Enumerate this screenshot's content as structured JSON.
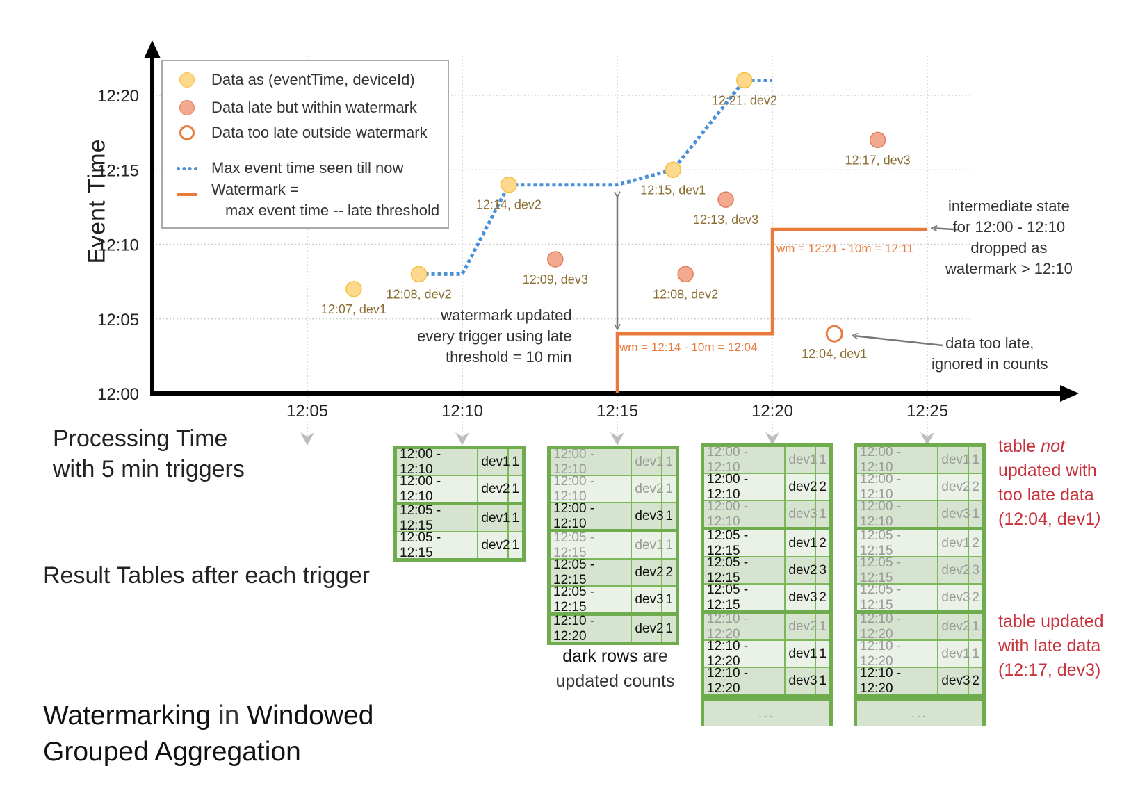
{
  "title": {
    "part1": "Watermarking",
    "part2": " in ",
    "part3": "Windowed",
    "line2": "Grouped Aggregation"
  },
  "labels": {
    "y_axis": "Event Time",
    "x_axis_line1": "Processing Time",
    "x_axis_line2": "with 5 min triggers",
    "result_tables": "Result Tables after each trigger",
    "dark_rows_1a": "dark rows",
    "dark_rows_1b": " are",
    "dark_rows_2": "updated counts"
  },
  "legend": {
    "items": [
      {
        "type": "ontime",
        "label": "Data as (eventTime, deviceId)"
      },
      {
        "type": "late",
        "label": "Data late but within watermark"
      },
      {
        "type": "toolate",
        "label": "Data too late outside watermark"
      },
      {
        "type": "maxline",
        "label": "Max event time seen till now"
      },
      {
        "type": "watermark",
        "label": "Watermark =",
        "label2": "max event time -- late threshold"
      }
    ]
  },
  "annotations": {
    "watermark_updated": [
      "watermark updated",
      "every trigger using late",
      "threshold = 10 min"
    ],
    "intermediate_state": [
      "intermediate state",
      "for 12:00 - 12:10",
      "dropped as",
      "watermark > 12:10"
    ],
    "too_late": [
      "data too late,",
      "ignored in counts"
    ],
    "wm1": "wm = 12:14 - 10m = 12:04",
    "wm2": "wm = 12:21 - 10m = 12:11",
    "not_updated": {
      "l1a": "table ",
      "l1b": "not",
      "l2": "updated with",
      "l3": "too late data",
      "l4a": "(12:04, dev1",
      "l4b": ")"
    },
    "updated_late": [
      "table updated",
      "with late data",
      "(12:17, dev3)"
    ]
  },
  "colors": {
    "ontime_fill": "#fed88c",
    "ontime_stroke": "#f4bf3c",
    "late_fill": "#f2a98f",
    "late_stroke": "#e07f5f",
    "toolate_stroke": "#e87a3c",
    "max_line": "#4a90d9",
    "watermark": "#e87a3c",
    "point_label": "#8b6d32",
    "table_border": "#6fac4d",
    "note_red": "#c8323c"
  },
  "chart_data": {
    "type": "scatter",
    "title": "Watermarking in Windowed Grouped Aggregation",
    "xlabel": "Processing Time with 5 min triggers",
    "ylabel": "Event Time",
    "x_ticks": [
      "12:05",
      "12:10",
      "12:15",
      "12:20",
      "12:25"
    ],
    "x_tick_values": [
      5,
      10,
      15,
      20,
      25
    ],
    "y_ticks": [
      "12:00",
      "12:05",
      "12:10",
      "12:15",
      "12:20"
    ],
    "y_tick_values": [
      0,
      5,
      10,
      15,
      20
    ],
    "xlim": [
      0,
      28.5
    ],
    "ylim": [
      0,
      22
    ],
    "grid": true,
    "points": [
      {
        "proc": 6.5,
        "event": 7,
        "label": "12:07, dev1",
        "kind": "ontime"
      },
      {
        "proc": 8.6,
        "event": 8,
        "label": "12:08, dev2",
        "kind": "ontime"
      },
      {
        "proc": 11.5,
        "event": 14,
        "label": "12:14, dev2",
        "kind": "ontime"
      },
      {
        "proc": 13.0,
        "event": 9,
        "label": "12:09, dev3",
        "kind": "late"
      },
      {
        "proc": 16.8,
        "event": 15,
        "label": "12:15, dev1",
        "kind": "ontime"
      },
      {
        "proc": 17.2,
        "event": 8,
        "label": "12:08, dev2",
        "kind": "late"
      },
      {
        "proc": 18.5,
        "event": 13,
        "label": "12:13, dev3",
        "kind": "late"
      },
      {
        "proc": 19.1,
        "event": 21,
        "label": "12:21, dev2",
        "kind": "ontime"
      },
      {
        "proc": 22.0,
        "event": 4,
        "label": "12:04, dev1",
        "kind": "toolate"
      },
      {
        "proc": 23.4,
        "event": 17,
        "label": "12:17, dev3",
        "kind": "late"
      }
    ],
    "max_event_line": [
      [
        8.6,
        8
      ],
      [
        10,
        8
      ],
      [
        11.5,
        14
      ],
      [
        15,
        14
      ],
      [
        16.8,
        15
      ],
      [
        19.1,
        21
      ],
      [
        20,
        21
      ]
    ],
    "watermark_line": [
      [
        15,
        0
      ],
      [
        15,
        4
      ],
      [
        20,
        4
      ],
      [
        20,
        11
      ],
      [
        25,
        11
      ]
    ]
  },
  "tables": [
    {
      "trigger": "12:10",
      "groups": [
        [
          {
            "win": "12:00 - 12:10",
            "dev": "dev1",
            "cnt": "1",
            "updated": true
          },
          {
            "win": "12:00 - 12:10",
            "dev": "dev2",
            "cnt": "1",
            "updated": true
          }
        ],
        [
          {
            "win": "12:05 - 12:15",
            "dev": "dev1",
            "cnt": "1",
            "updated": true
          },
          {
            "win": "12:05 - 12:15",
            "dev": "dev2",
            "cnt": "1",
            "updated": true
          }
        ]
      ],
      "ellipsis": false
    },
    {
      "trigger": "12:15",
      "groups": [
        [
          {
            "win": "12:00 - 12:10",
            "dev": "dev1",
            "cnt": "1",
            "updated": false
          },
          {
            "win": "12:00 - 12:10",
            "dev": "dev2",
            "cnt": "1",
            "updated": false
          },
          {
            "win": "12:00 - 12:10",
            "dev": "dev3",
            "cnt": "1",
            "updated": true
          }
        ],
        [
          {
            "win": "12:05 - 12:15",
            "dev": "dev1",
            "cnt": "1",
            "updated": false
          },
          {
            "win": "12:05 - 12:15",
            "dev": "dev2",
            "cnt": "2",
            "updated": true
          },
          {
            "win": "12:05 - 12:15",
            "dev": "dev3",
            "cnt": "1",
            "updated": true
          }
        ],
        [
          {
            "win": "12:10 - 12:20",
            "dev": "dev2",
            "cnt": "1",
            "updated": true
          }
        ]
      ],
      "ellipsis": false
    },
    {
      "trigger": "12:20",
      "groups": [
        [
          {
            "win": "12:00 - 12:10",
            "dev": "dev1",
            "cnt": "1",
            "updated": false
          },
          {
            "win": "12:00 - 12:10",
            "dev": "dev2",
            "cnt": "2",
            "updated": true
          },
          {
            "win": "12:00 - 12:10",
            "dev": "dev3",
            "cnt": "1",
            "updated": false
          }
        ],
        [
          {
            "win": "12:05 - 12:15",
            "dev": "dev1",
            "cnt": "2",
            "updated": true
          },
          {
            "win": "12:05 - 12:15",
            "dev": "dev2",
            "cnt": "3",
            "updated": true
          },
          {
            "win": "12:05 - 12:15",
            "dev": "dev3",
            "cnt": "2",
            "updated": true
          }
        ],
        [
          {
            "win": "12:10 - 12:20",
            "dev": "dev2",
            "cnt": "1",
            "updated": false
          },
          {
            "win": "12:10 - 12:20",
            "dev": "dev1",
            "cnt": "1",
            "updated": true
          },
          {
            "win": "12:10 - 12:20",
            "dev": "dev3",
            "cnt": "1",
            "updated": true
          }
        ]
      ],
      "ellipsis": true,
      "ellipsis_text": "..."
    },
    {
      "trigger": "12:25",
      "groups": [
        [
          {
            "win": "12:00 - 12:10",
            "dev": "dev1",
            "cnt": "1",
            "updated": false
          },
          {
            "win": "12:00 - 12:10",
            "dev": "dev2",
            "cnt": "2",
            "updated": false
          },
          {
            "win": "12:00 - 12:10",
            "dev": "dev3",
            "cnt": "1",
            "updated": false
          }
        ],
        [
          {
            "win": "12:05 - 12:15",
            "dev": "dev1",
            "cnt": "2",
            "updated": false
          },
          {
            "win": "12:05 - 12:15",
            "dev": "dev2",
            "cnt": "3",
            "updated": false
          },
          {
            "win": "12:05 - 12:15",
            "dev": "dev3",
            "cnt": "2",
            "updated": false
          }
        ],
        [
          {
            "win": "12:10 - 12:20",
            "dev": "dev2",
            "cnt": "1",
            "updated": false
          },
          {
            "win": "12:10 - 12:20",
            "dev": "dev1",
            "cnt": "1",
            "updated": false
          },
          {
            "win": "12:10 - 12:20",
            "dev": "dev3",
            "cnt": "2",
            "updated": true
          }
        ]
      ],
      "ellipsis": true,
      "ellipsis_text": "..."
    }
  ]
}
